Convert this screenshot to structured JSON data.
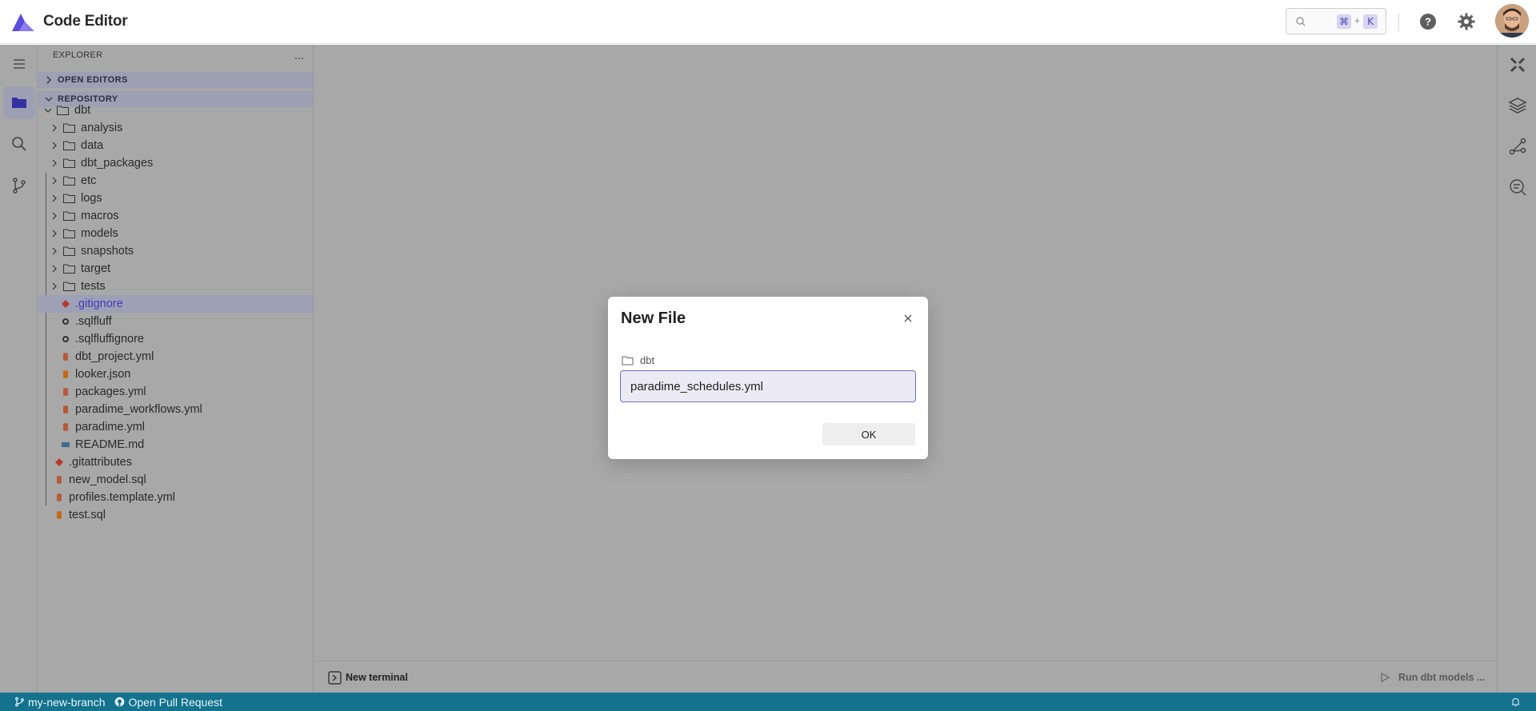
{
  "header": {
    "app_title": "Code Editor",
    "search": {
      "placeholder": "",
      "shortcut_mod": "⌘",
      "shortcut_plus": "+",
      "shortcut_key": "K"
    }
  },
  "colors": {
    "brand": "#6b5ce7",
    "overlay": "#a8a8a8",
    "status_bar": "#14728f",
    "input_border": "#6b67cf",
    "selected_text": "#3e3cb8"
  },
  "sidebar": {
    "title": "EXPLORER",
    "more": "...",
    "sections": {
      "open_editors": "OPEN EDITORS",
      "repository": "REPOSITORY"
    },
    "tree": [
      {
        "name": "dbt",
        "type": "folder",
        "expanded": true
      },
      {
        "name": "analysis",
        "type": "folder"
      },
      {
        "name": "data",
        "type": "folder"
      },
      {
        "name": "dbt_packages",
        "type": "folder"
      },
      {
        "name": "etc",
        "type": "folder"
      },
      {
        "name": "logs",
        "type": "folder"
      },
      {
        "name": "macros",
        "type": "folder"
      },
      {
        "name": "models",
        "type": "folder"
      },
      {
        "name": "snapshots",
        "type": "folder"
      },
      {
        "name": "target",
        "type": "folder"
      },
      {
        "name": "tests",
        "type": "folder"
      },
      {
        "name": ".gitignore",
        "type": "git-file",
        "selected": true
      },
      {
        "name": ".sqlfluff",
        "type": "config-file"
      },
      {
        "name": ".sqlfluffignore",
        "type": "config-file"
      },
      {
        "name": "dbt_project.yml",
        "type": "db-file"
      },
      {
        "name": "looker.json",
        "type": "json-file"
      },
      {
        "name": "packages.yml",
        "type": "db-file"
      },
      {
        "name": "paradime_workflows.yml",
        "type": "db-file"
      },
      {
        "name": "paradime.yml",
        "type": "db-file"
      },
      {
        "name": "README.md",
        "type": "markdown-file"
      },
      {
        "name": ".gitattributes",
        "type": "git-file"
      },
      {
        "name": "new_model.sql",
        "type": "db-file"
      },
      {
        "name": "profiles.template.yml",
        "type": "db-file"
      },
      {
        "name": "test.sql",
        "type": "json-file"
      }
    ]
  },
  "panel": {
    "new_terminal": "New terminal",
    "run_models": "Run dbt models ..."
  },
  "status_bar": {
    "branch": "my-new-branch",
    "pull_request": "Open Pull Request"
  },
  "modal": {
    "title": "New File",
    "path": "dbt",
    "input_value": "paradime_schedules.yml",
    "ok_label": "OK"
  }
}
